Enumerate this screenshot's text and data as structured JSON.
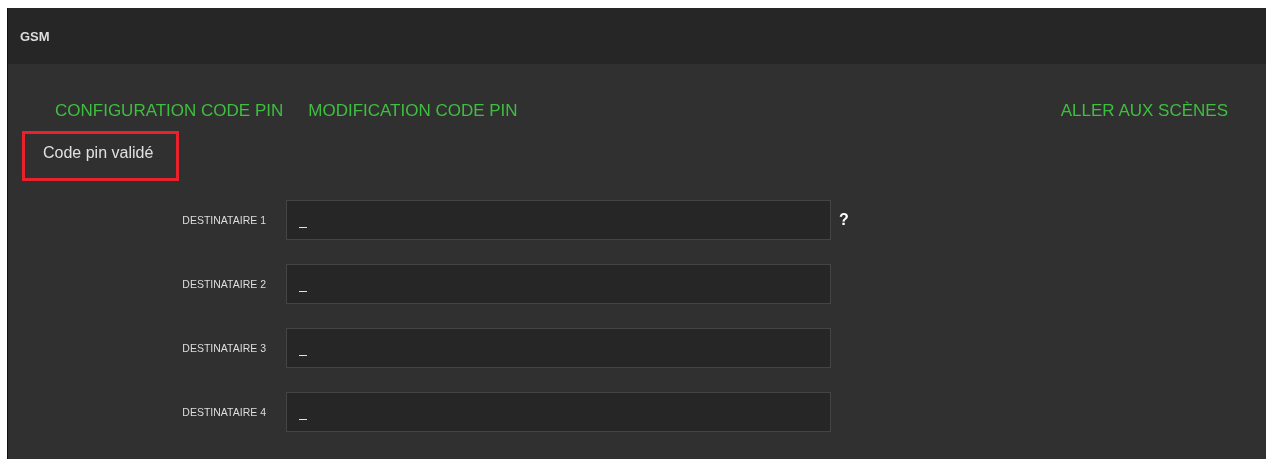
{
  "panel": {
    "title": "GSM"
  },
  "nav_links": [
    {
      "label": "CONFIGURATION CODE PIN"
    },
    {
      "label": "MODIFICATION CODE PIN"
    }
  ],
  "scenes_link": {
    "label": "ALLER AUX SCÈNES"
  },
  "status": {
    "text": "Code pin validé",
    "highlighted": true
  },
  "recipients": [
    {
      "label": "DESTINATAIRE 1",
      "value": "_",
      "help": "?"
    },
    {
      "label": "DESTINATAIRE 2",
      "value": "_"
    },
    {
      "label": "DESTINATAIRE 3",
      "value": "_"
    },
    {
      "label": "DESTINATAIRE 4",
      "value": "_"
    }
  ]
}
